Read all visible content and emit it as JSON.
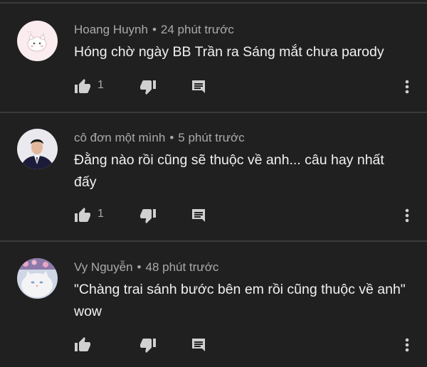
{
  "comments": [
    {
      "author": "Hoang Huynh",
      "time": "24 phút trước",
      "text": "Hóng chờ ngày BB Trần ra Sáng mắt chưa parody",
      "likes": "1",
      "avatar_icon": "cartoon-cat-avatar"
    },
    {
      "author": "cô đơn một mình",
      "time": "5 phút trước",
      "text": "Đằng nào rồi cũng sẽ thuộc về anh... câu hay nhất đấy",
      "likes": "1",
      "avatar_icon": "man-in-suit-avatar"
    },
    {
      "author": "Vy Nguyễn",
      "time": "48 phút trước",
      "text": "\"Chàng trai sánh bước bên em rồi cũng thuộc về anh\" wow",
      "likes": "",
      "avatar_icon": "white-cat-avatar"
    }
  ],
  "separator": "•",
  "colors": {
    "background": "#202020",
    "text": "#f1f1f1",
    "secondary": "#aaaaaa",
    "divider": "#3a3a3a"
  }
}
